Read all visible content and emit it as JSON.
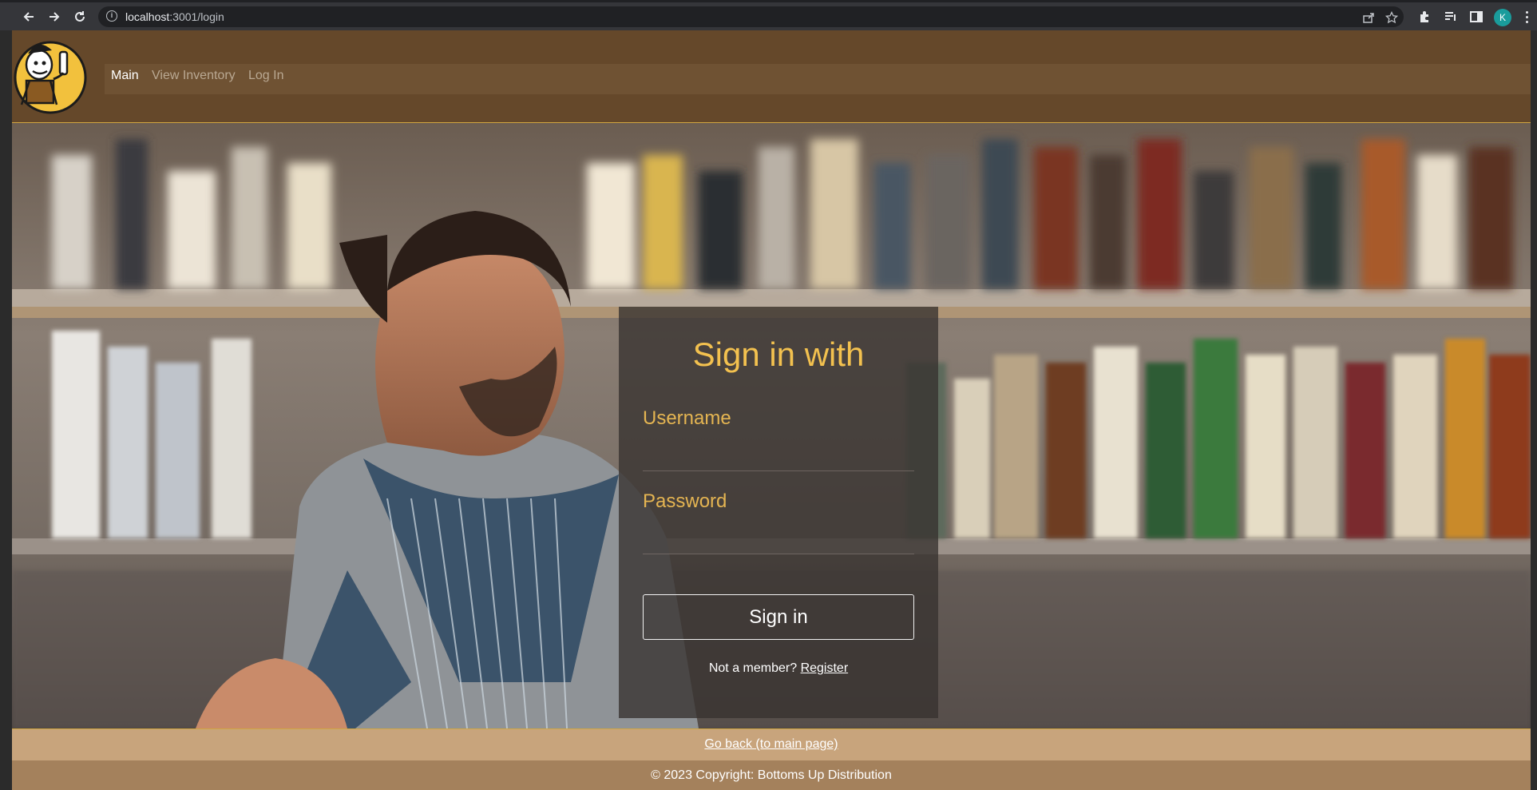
{
  "browser": {
    "url_host": "localhost",
    "url_rest": ":3001/login",
    "profile_initial": "K"
  },
  "nav": {
    "items": [
      {
        "label": "Main",
        "active": true
      },
      {
        "label": "View Inventory",
        "active": false
      },
      {
        "label": "Log In",
        "active": false
      }
    ]
  },
  "login": {
    "title": "Sign in with",
    "username_label": "Username",
    "password_label": "Password",
    "signin_label": "Sign in",
    "register_prompt": "Not a member?",
    "register_link": "Register"
  },
  "footer": {
    "go_back": "Go back (to main page)",
    "copyright": "© 2023 Copyright: Bottoms Up Distribution"
  },
  "colors": {
    "header_bg": "#65482a",
    "accent_gold": "#f3c14f",
    "footer_light": "#c8a47c",
    "footer_dark": "#a4815c"
  }
}
